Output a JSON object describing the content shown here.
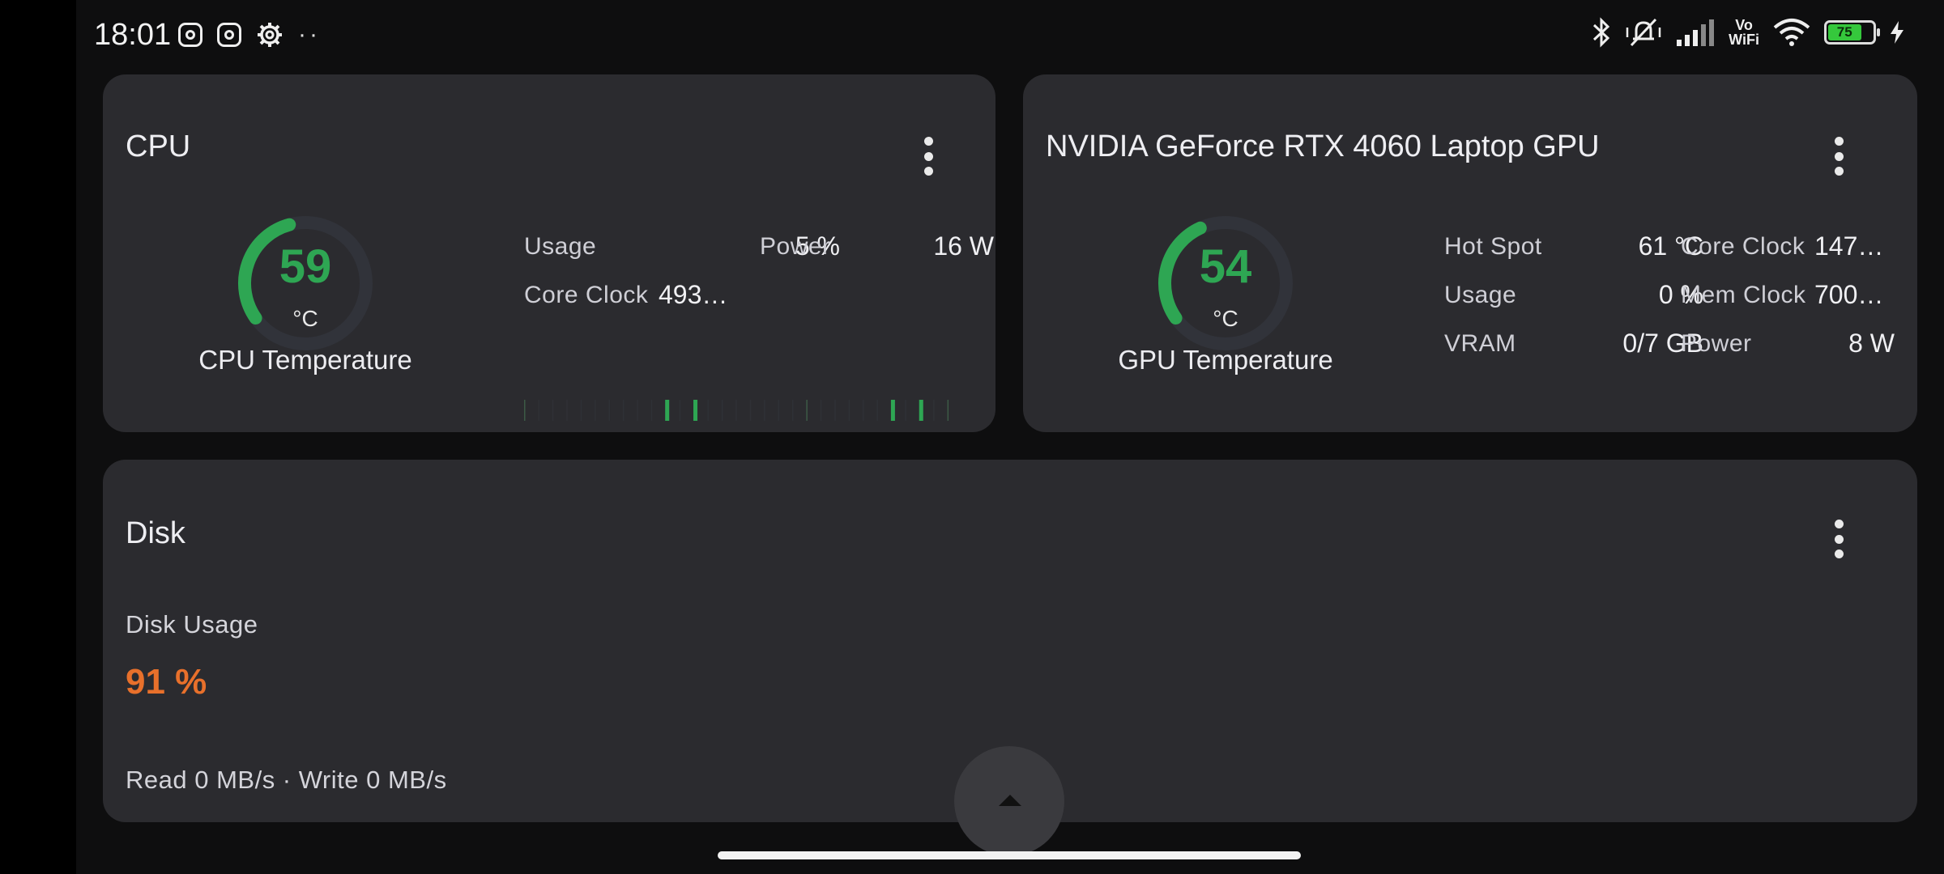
{
  "status_bar": {
    "time": "18:01",
    "left_icons": [
      "instagram-icon",
      "instagram-icon",
      "settings-gear-icon",
      "more-notifications-icon"
    ],
    "right_icons": [
      "bluetooth-icon",
      "mute-vibrate-icon",
      "signal-icon",
      "vowifi-icon",
      "wifi-icon",
      "battery-icon",
      "charging-icon"
    ],
    "vowifi_top": "Vo",
    "vowifi_bottom": "WiFi",
    "battery_level": "75"
  },
  "cpu_card": {
    "title": "CPU",
    "temperature": {
      "value": "59",
      "unit": "°C",
      "label": "CPU Temperature",
      "fraction": 0.59
    },
    "metrics": [
      {
        "label": "Usage",
        "value": "5 %"
      },
      {
        "label": "Power",
        "value": "16 W"
      },
      {
        "label": "Core Clock",
        "value": "493…"
      }
    ],
    "usage_history": [
      0,
      0,
      0,
      0,
      0,
      0,
      0,
      0,
      0,
      0,
      1,
      0,
      1,
      0,
      0,
      0,
      0,
      0,
      0,
      0,
      0,
      0,
      0,
      0,
      0,
      0,
      1,
      0,
      1,
      0,
      0
    ]
  },
  "gpu_card": {
    "title": "NVIDIA GeForce RTX 4060 Laptop GPU",
    "temperature": {
      "value": "54",
      "unit": "°C",
      "label": "GPU Temperature",
      "fraction": 0.54
    },
    "metrics": [
      {
        "label": "Hot Spot",
        "value": "61 °C"
      },
      {
        "label": "Core Clock",
        "value": "147…"
      },
      {
        "label": "Usage",
        "value": "0 %"
      },
      {
        "label": "Mem Clock",
        "value": "700…"
      },
      {
        "label": "VRAM",
        "value": "0/7 GB"
      },
      {
        "label": "Power",
        "value": "8 W"
      }
    ]
  },
  "disk_card": {
    "title": "Disk",
    "usage_label": "Disk Usage",
    "usage_value": "91 %",
    "io_text": "Read 0 MB/s · Write 0 MB/s"
  },
  "colors": {
    "gauge_green": "#2ea653",
    "disk_orange": "#e8702b",
    "card_bg": "#2b2b2f"
  }
}
